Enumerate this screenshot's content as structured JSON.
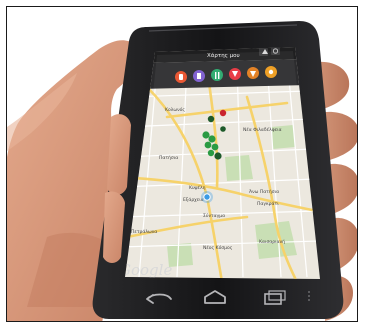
{
  "app": {
    "title": "Χάρτης μου",
    "map_brand": "Google"
  },
  "toolbar": {
    "categories": [
      {
        "name": "category-food-icon",
        "color": "#e8502a"
      },
      {
        "name": "category-culture-icon",
        "color": "#7c5bd0"
      },
      {
        "name": "category-leisure-icon",
        "color": "#27a86b"
      },
      {
        "name": "category-shopping-icon",
        "color": "#e7333d"
      },
      {
        "name": "category-drinks-icon",
        "color": "#e27c1b"
      },
      {
        "name": "category-services-icon",
        "color": "#ee9b1b"
      }
    ],
    "right_icons": [
      "layers-icon",
      "settings-icon"
    ]
  },
  "map": {
    "labels": {
      "top_left": "Κολωνός",
      "center_right": "Νέα Φιλαδέλφεια",
      "mid": "Πατήσια",
      "center": "Κυψέλη",
      "center_low": "Εξάρχεια",
      "right_mid": "Άνω Πατήσια",
      "lower_center": "Σύνταγμα",
      "lower_right": "Παγκράτι",
      "bottom_left": "Πετράλωνα",
      "bottom_center": "Νέος Κόσμος",
      "bottom_right": "Καισαριανή"
    },
    "colors": {
      "land": "#ece8df",
      "park": "#c9dfb5",
      "major_road": "#f6d26a",
      "minor_road": "#ffffff",
      "marker_green": "#2a9b43",
      "marker_dark": "#1d5a2a",
      "marker_red": "#c9242d",
      "location_dot": "#3b9be5"
    }
  },
  "nav_bar": {
    "buttons": [
      "back-icon",
      "home-icon",
      "recent-apps-icon"
    ]
  }
}
